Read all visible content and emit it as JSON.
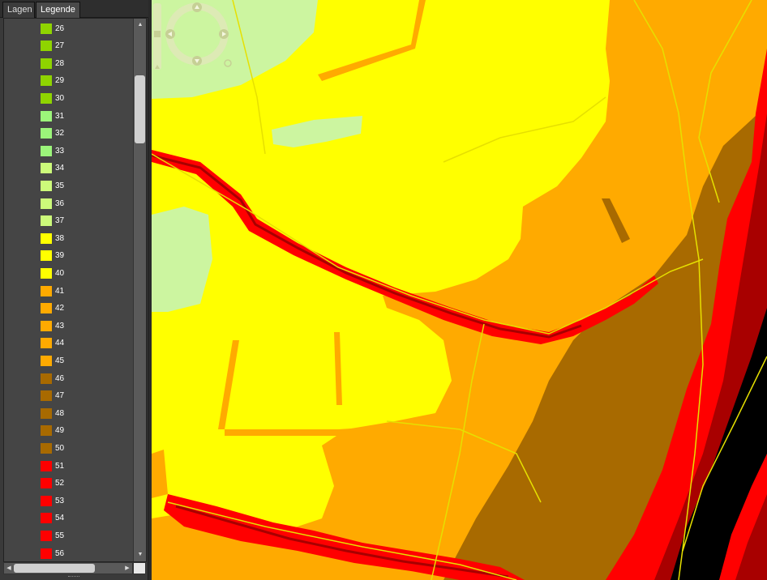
{
  "tabs": [
    {
      "label": "Lagen"
    },
    {
      "label": "Legende"
    }
  ],
  "legend": {
    "items": [
      {
        "label": "26",
        "color": "#8fd400"
      },
      {
        "label": "27",
        "color": "#8fd400"
      },
      {
        "label": "28",
        "color": "#8fd400"
      },
      {
        "label": "29",
        "color": "#8fd400"
      },
      {
        "label": "30",
        "color": "#8fd400"
      },
      {
        "label": "31",
        "color": "#9cf57a"
      },
      {
        "label": "32",
        "color": "#9cf57a"
      },
      {
        "label": "33",
        "color": "#9cf57a"
      },
      {
        "label": "34",
        "color": "#ccfa7a"
      },
      {
        "label": "35",
        "color": "#ccfa7a"
      },
      {
        "label": "36",
        "color": "#ccfa7a"
      },
      {
        "label": "37",
        "color": "#ccfa7a"
      },
      {
        "label": "38",
        "color": "#ffff00"
      },
      {
        "label": "39",
        "color": "#ffff00"
      },
      {
        "label": "40",
        "color": "#ffff00"
      },
      {
        "label": "41",
        "color": "#ffaa00"
      },
      {
        "label": "42",
        "color": "#ffaa00"
      },
      {
        "label": "43",
        "color": "#ffaa00"
      },
      {
        "label": "44",
        "color": "#ffaa00"
      },
      {
        "label": "45",
        "color": "#ffaa00"
      },
      {
        "label": "46",
        "color": "#a86a00"
      },
      {
        "label": "47",
        "color": "#a86a00"
      },
      {
        "label": "48",
        "color": "#a86a00"
      },
      {
        "label": "49",
        "color": "#a86a00"
      },
      {
        "label": "50",
        "color": "#a86a00"
      },
      {
        "label": "51",
        "color": "#ff0000"
      },
      {
        "label": "52",
        "color": "#ff0000"
      },
      {
        "label": "53",
        "color": "#ff0000"
      },
      {
        "label": "54",
        "color": "#ff0000"
      },
      {
        "label": "55",
        "color": "#ff0000"
      },
      {
        "label": "56",
        "color": "#ff0000"
      }
    ]
  },
  "map": {
    "colors": {
      "light_green": "#ccf5a0",
      "yellow": "#ffff00",
      "orange": "#ffaa00",
      "brown": "#a86a00",
      "red": "#ff0000",
      "dark_red": "#a80000",
      "black": "#000000",
      "road": "#e6e000"
    }
  }
}
